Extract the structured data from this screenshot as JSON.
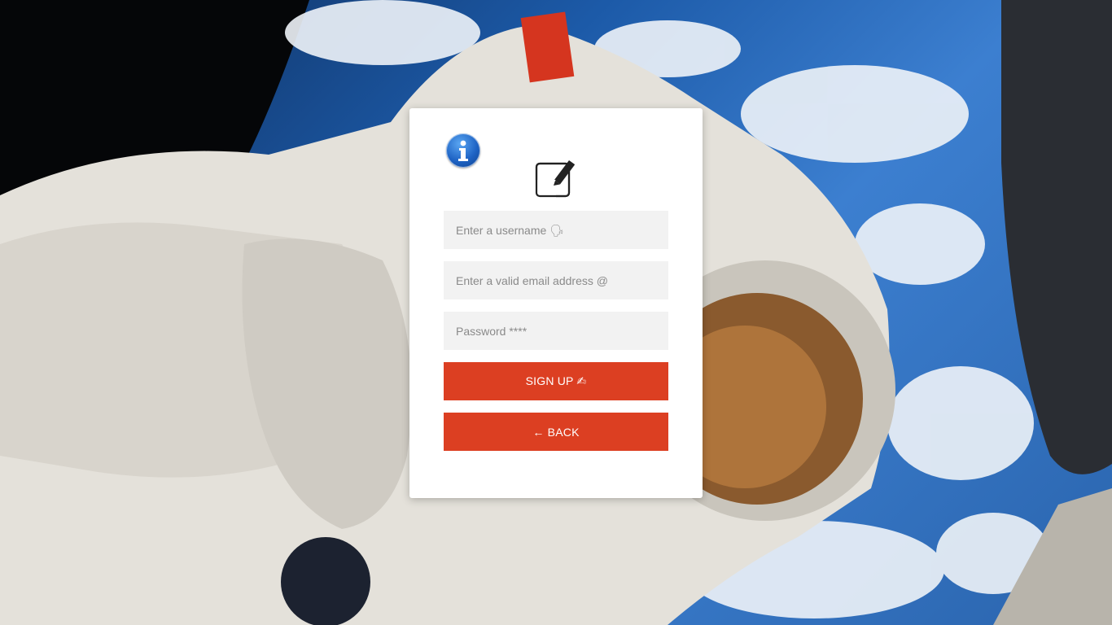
{
  "form": {
    "username_placeholder": "Enter a username 🗣",
    "email_placeholder": "Enter a valid email address @",
    "password_placeholder": "Password ****",
    "signup_label": "SIGN UP ✍",
    "back_label": "← BACK"
  },
  "icons": {
    "info": "info-icon",
    "edit": "edit-icon"
  },
  "colors": {
    "accent": "#dc3f22",
    "card": "#ffffff",
    "field_bg": "#f2f2f2",
    "info_blue": "#1e63c4"
  }
}
